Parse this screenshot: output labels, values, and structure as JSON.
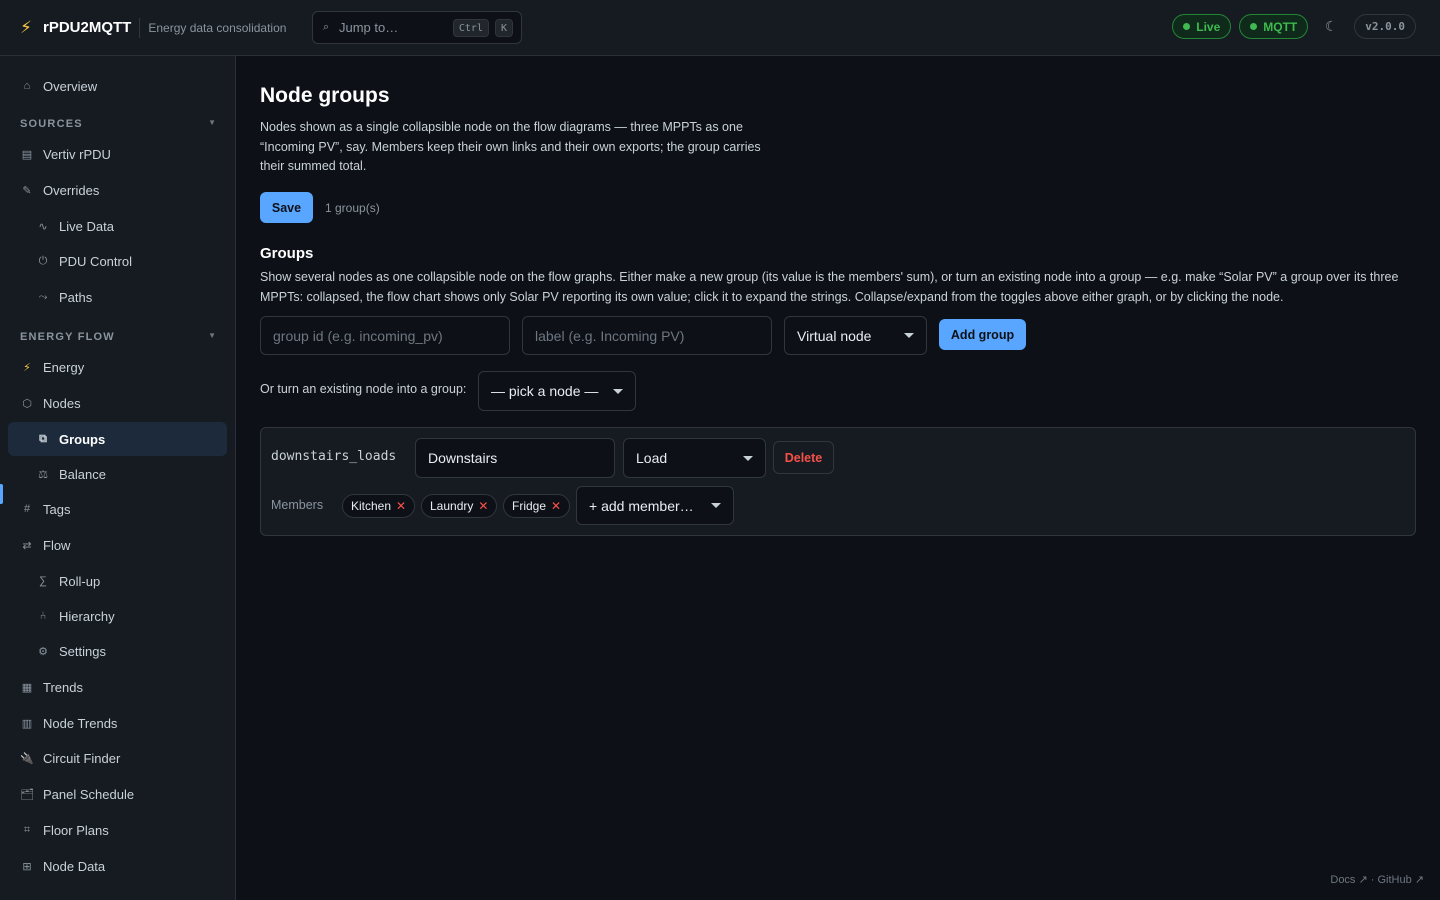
{
  "app": {
    "name": "rPDU2MQTT",
    "tagline": "Energy data consolidation",
    "version": "v2.0.0",
    "jump": {
      "placeholder": "Jump to…",
      "kbd1": "Ctrl",
      "kbd2": "K"
    },
    "status": [
      {
        "label": "Live",
        "color": "#3fb950"
      },
      {
        "label": "MQTT",
        "color": "#3fb950"
      }
    ],
    "icons": {
      "brand": "bolt-icon",
      "jump": "search-icon",
      "theme": "moon-icon"
    }
  },
  "sidebar": {
    "overview": {
      "label": "Overview",
      "icon": "home-icon"
    },
    "sections": {
      "sources": "SOURCES",
      "energy_flow": "ENERGY FLOW"
    },
    "items": {
      "vertiv": {
        "label": "Vertiv rPDU",
        "icon": "server-icon"
      },
      "overrides": {
        "label": "Overrides",
        "icon": "pencil-icon"
      },
      "live_data": {
        "label": "Live Data",
        "icon": "wave-icon"
      },
      "pdu_control": {
        "label": "PDU Control",
        "icon": "power-icon"
      },
      "paths": {
        "label": "Paths",
        "icon": "route-icon"
      },
      "energy": {
        "label": "Energy",
        "icon": "bolt-icon"
      },
      "nodes": {
        "label": "Nodes",
        "icon": "hexagon-icon"
      },
      "groups": {
        "label": "Groups",
        "icon": "copy-icon"
      },
      "balance": {
        "label": "Balance",
        "icon": "scale-icon"
      },
      "tags": {
        "label": "Tags",
        "icon": "hash-icon"
      },
      "flow": {
        "label": "Flow",
        "icon": "arrows-icon"
      },
      "rollup": {
        "label": "Roll-up",
        "icon": "sigma-icon"
      },
      "hierarchy": {
        "label": "Hierarchy",
        "icon": "tree-icon"
      },
      "settings": {
        "label": "Settings",
        "icon": "gear-icon"
      },
      "trends": {
        "label": "Trends",
        "icon": "chart-icon"
      },
      "node_trends": {
        "label": "Node Trends",
        "icon": "chart-icon"
      },
      "circuit_finder": {
        "label": "Circuit Finder",
        "icon": "plug-icon"
      },
      "panel_schedule": {
        "label": "Panel Schedule",
        "icon": "folder-icon"
      },
      "floor_plans": {
        "label": "Floor Plans",
        "icon": "grid-icon"
      },
      "node_data": {
        "label": "Node Data",
        "icon": "table-icon"
      }
    },
    "active": "groups"
  },
  "main": {
    "title": "Node groups",
    "description": "Nodes shown as a single collapsible node on the flow diagrams — three MPPTs as one “Incoming PV”, say. Members keep their own links and their own exports; the group carries their summed total.",
    "save_label": "Save",
    "group_count": "1 group(s)",
    "groups_heading": "Groups",
    "groups_description": "Show several nodes as one collapsible node on the flow graphs. Either make a new group (its value is the members' sum), or turn an existing node into a group — e.g. make “Solar PV” a group over its three MPPTs: collapsed, the flow chart shows only Solar PV reporting its own value; click it to expand the strings. Collapse/expand from the toggles above either graph, or by clicking the node.",
    "new_group": {
      "id_placeholder": "group id (e.g. incoming_pv)",
      "label_placeholder": "label (e.g. Incoming PV)",
      "type_value": "Virtual node",
      "add_label": "Add group"
    },
    "convert": {
      "label": "Or turn an existing node into a group:",
      "select_value": "— pick a node —"
    },
    "groups": [
      {
        "id": "downstairs_loads",
        "label": "Downstairs",
        "type": "Load",
        "delete_label": "Delete",
        "members_label": "Members",
        "members": [
          "Kitchen",
          "Laundry",
          "Fridge"
        ],
        "add_member": "+ add member…"
      }
    ]
  },
  "footer": {
    "links": "Docs ↗ · GitHub ↗"
  }
}
